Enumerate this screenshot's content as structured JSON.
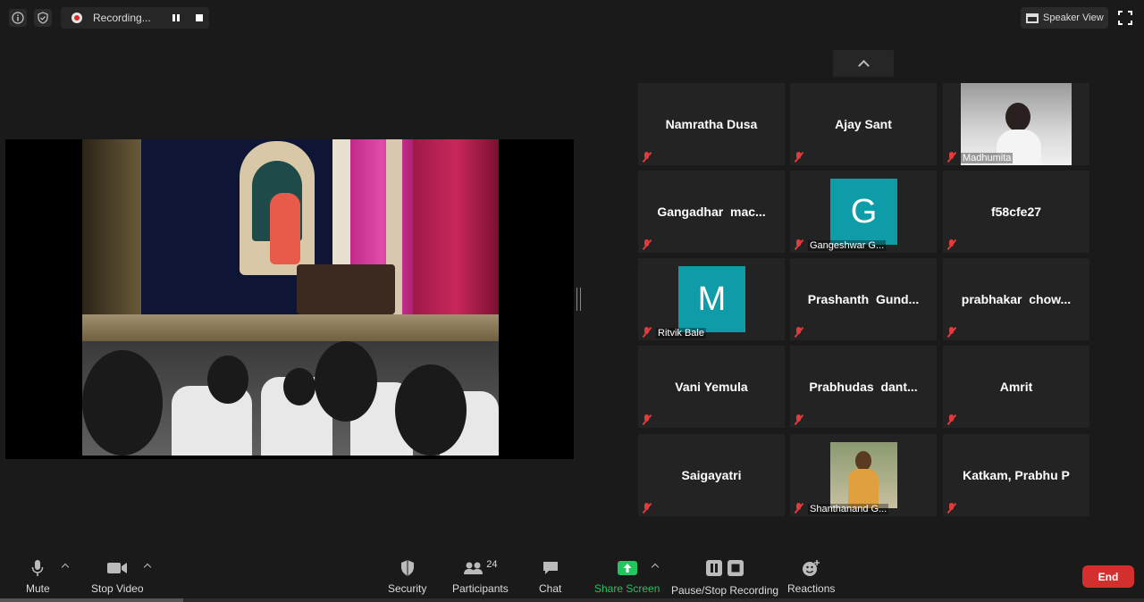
{
  "topbar": {
    "info_icon": "info-icon",
    "shield_icon": "shield-check-icon",
    "recording_label": "Recording...",
    "speaker_view_label": "Speaker View"
  },
  "gallery": {
    "tiles": [
      {
        "name": "Namratha Dusa",
        "type": "text"
      },
      {
        "name": "Ajay Sant",
        "type": "text"
      },
      {
        "name": "Madhumita",
        "type": "photo"
      },
      {
        "name": "Gangadhar  mac...",
        "type": "text"
      },
      {
        "name": "Gangeshwar G...",
        "type": "avatar",
        "initial": "G"
      },
      {
        "name": "f58cfe27",
        "type": "text"
      },
      {
        "name": "Ritvik Bale",
        "type": "avatar",
        "initial": "M"
      },
      {
        "name": "Prashanth  Gund...",
        "type": "text"
      },
      {
        "name": "prabhakar  chow...",
        "type": "text"
      },
      {
        "name": "Vani Yemula",
        "type": "text"
      },
      {
        "name": "Prabhudas  dant...",
        "type": "text"
      },
      {
        "name": "Amrit",
        "type": "text"
      },
      {
        "name": "Saigayatri",
        "type": "text"
      },
      {
        "name": "Shanthanand G...",
        "type": "photo"
      },
      {
        "name": "Katkam, Prabhu P",
        "type": "text"
      }
    ],
    "avatar_color": "#0e9ca8",
    "muted_color": "#e23b3b"
  },
  "toolbar": {
    "mute": "Mute",
    "stop_video": "Stop Video",
    "security": "Security",
    "participants": "Participants",
    "participants_count": "24",
    "chat": "Chat",
    "share_screen": "Share Screen",
    "share_color": "#22c55e",
    "pause_stop_recording": "Pause/Stop Recording",
    "reactions": "Reactions",
    "end": "End",
    "end_color": "#d32f2f"
  }
}
